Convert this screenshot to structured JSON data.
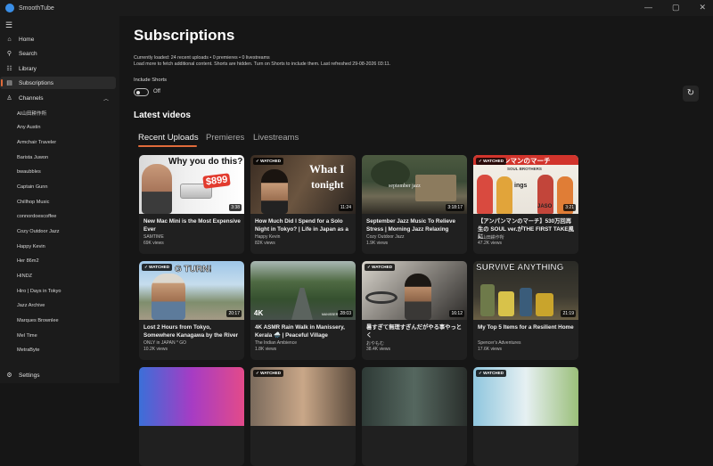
{
  "app": {
    "title": "SmoothTube"
  },
  "window_controls": [
    "—",
    "▢",
    "✕"
  ],
  "nav": {
    "home": "Home",
    "search": "Search",
    "library": "Library",
    "subscriptions": "Subscriptions",
    "channels": "Channels",
    "settings": "Settings"
  },
  "channels": [
    "AI山田耕作所",
    "Any Austin",
    "Armchair Traveler",
    "Barista Juwon",
    "bwaubbles",
    "Captain Gunn",
    "Chillhop Music",
    "connordoescoffee",
    "Cozy Outdoor Jazz",
    "Happy Kevin",
    "Her 86m2",
    "HINDZ",
    "Hiro | Days in Tokyo",
    "Jazz Archive",
    "Marques Brownlee",
    "Mel Time",
    "MetraByte"
  ],
  "page": {
    "title": "Subscriptions",
    "info_line1": "Currently loaded: 24 recent uploads • 0 premieres • 0 livestreams",
    "info_line2": "Load more to fetch additional content. Shorts are hidden. Turn on Shorts to include them. Last refreshed 29-08-2026 03:11.",
    "include_shorts_label": "Include Shorts",
    "include_shorts_state": "Off",
    "section_title": "Latest videos"
  },
  "tabs": [
    "Recent Uploads",
    "Premieres",
    "Livestreams"
  ],
  "watched_label": "WATCHED",
  "videos": [
    {
      "title": "New Mac Mini is the Most Expensive Ever",
      "channel": "SAMTIME",
      "views": "69K views",
      "duration": "3:38",
      "watched": false
    },
    {
      "title": "How Much Did I Spend for a Solo Night in Tokyo? | Life in Japan as a",
      "channel": "Happy Kevin",
      "views": "82K views",
      "duration": "11:24",
      "watched": true
    },
    {
      "title": "September Jazz Music To Relieve Stress | Morning Jazz Relaxing",
      "channel": "Cozy Outdoor Jazz",
      "views": "1.9K views",
      "duration": "3:18:17",
      "watched": false
    },
    {
      "title": "【アンパンマンのマーチ】530万回再生の SOUL ver.がTHE FIRST TAKE風に",
      "channel": "AI山田耕作所",
      "views": "47.2K views",
      "duration": "3:21",
      "watched": true
    },
    {
      "title": "Lost 2 Hours from Tokyo, Somewhere Kanagawa by the River",
      "channel": "ONLY in JAPAN * GO",
      "views": "10.2K views",
      "duration": "20:17",
      "watched": true
    },
    {
      "title": "4K ASMR Rain Walk in Manissery, Kerala 🌧️ | Peaceful Village",
      "channel": "The Indian Ambience",
      "views": "1.8K views",
      "duration": "28:03",
      "watched": false
    },
    {
      "title": "暑すぎて無理すぎんだがやる事やっとく",
      "channel": "おやもむ",
      "views": "38.4K views",
      "duration": "16:12",
      "watched": true
    },
    {
      "title": "My Top 5 Items for a Resilient Home",
      "channel": "Spencer's Adventures",
      "views": "17.6K views",
      "duration": "21:19",
      "watched": false
    },
    {
      "title": "",
      "channel": "",
      "views": "",
      "duration": "",
      "watched": false
    },
    {
      "title": "",
      "channel": "",
      "views": "",
      "duration": "",
      "watched": true
    },
    {
      "title": "",
      "channel": "",
      "views": "",
      "duration": "",
      "watched": false
    },
    {
      "title": "",
      "channel": "",
      "views": "",
      "duration": "",
      "watched": true
    }
  ],
  "thumb_text": {
    "v0_caption": "Why you do this?",
    "v0_price": "$899",
    "v1_line1": "What I",
    "v1_line2": "tonight",
    "v2_text": "september jazz",
    "v3_top": "ンマンのマーチ",
    "v3_band": "SOUL BROTHERS",
    "v3_mid": "ings",
    "v3_id": "JASO",
    "v4_banner": "G TURN!",
    "v5_badge": "4K",
    "v5_brand": "MANISSERY",
    "v7_banner": "SURVIVE ANYTHING"
  },
  "colors": {
    "accent": "#e06b3a",
    "background": "#161616",
    "sidebar": "#1b1b1b",
    "card": "#202020"
  }
}
